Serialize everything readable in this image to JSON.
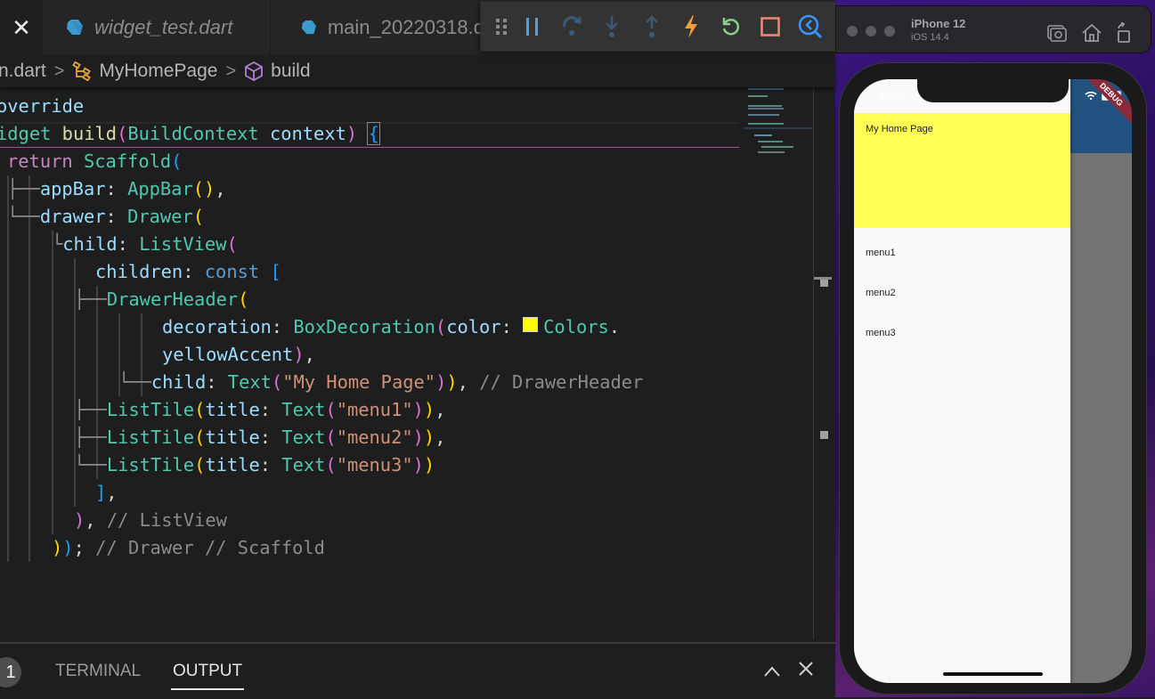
{
  "editor": {
    "tabs": [
      {
        "label": "",
        "icon": "close-icon",
        "active": true
      },
      {
        "label": "widget_test.dart",
        "icon": "dart-icon",
        "italic": true
      },
      {
        "label": "main_20220318.d",
        "icon": "dart-icon"
      }
    ],
    "debug_toolbar": [
      {
        "name": "drag-grip-icon"
      },
      {
        "name": "pause-icon",
        "label": "Pause"
      },
      {
        "name": "step-over-icon",
        "label": "Step Over"
      },
      {
        "name": "step-into-icon",
        "label": "Step Into"
      },
      {
        "name": "step-out-icon",
        "label": "Step Out"
      },
      {
        "name": "hot-reload-icon",
        "label": "Hot Reload",
        "color": "#f0a030"
      },
      {
        "name": "hot-restart-icon",
        "label": "Hot Restart",
        "color": "#89d185"
      },
      {
        "name": "stop-icon",
        "label": "Stop",
        "color": "#f48771"
      },
      {
        "name": "devtools-icon",
        "label": "Open DevTools",
        "color": "#3794ff"
      }
    ],
    "breadcrumb": {
      "file": "n.dart",
      "class": "MyHomePage",
      "method": "build"
    },
    "code_lines": [
      "override",
      "idget build(BuildContext context) {",
      " return Scaffold(",
      "  appBar: AppBar(),",
      "  drawer: Drawer(",
      "    child: ListView(",
      "      children: const [",
      "        DrawerHeader(",
      "            decoration: BoxDecoration(color: Colors.",
      "            yellowAccent),",
      "            child: Text(\"My Home Page\")), // DrawerHeader",
      "        ListTile(title: Text(\"menu1\")),",
      "        ListTile(title: Text(\"menu2\")),",
      "        ListTile(title: Text(\"menu3\"))",
      "      ],",
      "    ), // ListView",
      "  )); // Drawer // Scaffold"
    ],
    "tokens": {
      "l0": "override",
      "l1a": "idget ",
      "l1b": "build",
      "l1c": "(",
      "l1d": "BuildContext",
      "l1e": " context",
      "l1f": ")",
      "l1g": " ",
      "l1h": "{",
      "l2a": "return",
      "l2b": " Scaffold",
      "l2c": "(",
      "l3g": "├──",
      "l3a": "appBar",
      "l3b": ": ",
      "l3c": "AppBar",
      "l3d": "()",
      "l3e": ",",
      "l4g": "└──",
      "l4a": "drawer",
      "l4b": ": ",
      "l4c": "Drawer",
      "l4d": "(",
      "l5g": "└",
      "l5a": "child",
      "l5b": ": ",
      "l5c": "ListView",
      "l5d": "(",
      "l6a": "children",
      "l6b": ": ",
      "l6c": "const",
      "l6d": " [",
      "l7g": "├──",
      "l7a": "DrawerHeader",
      "l7b": "(",
      "l8a": "decoration",
      "l8b": ": ",
      "l8c": "BoxDecoration",
      "l8d": "(",
      "l8e": "color",
      "l8f": ": ",
      "l8h": "Colors",
      "l8i": ".",
      "l9a": "yellowAccent",
      "l9b": ")",
      "l9c": ",",
      "l10g": "└──",
      "l10a": "child",
      "l10b": ": ",
      "l10c": "Text",
      "l10d": "(",
      "l10e": "\"My Home Page\"",
      "l10f": ")",
      "l10h": ")",
      "l10i": ", ",
      "l10j": "// DrawerHeader",
      "l11g": "├──",
      "l12g": "├──",
      "l13g": "└──",
      "lt": "ListTile",
      "lp": "(",
      "lta": "title",
      "ltb": ": ",
      "ltc": "Text",
      "ltd": "(",
      "m1": "\"menu1\"",
      "m2": "\"menu2\"",
      "m3": "\"menu3\"",
      "lte": ")",
      "ltf": ")",
      "ltcomma": ",",
      "l14a": "]",
      "l14b": ",",
      "l15a": ")",
      "l15b": ", ",
      "l15c": "// ListView",
      "l16a": ")",
      "l16b": ")",
      "l16c": "; ",
      "l16d": "// Drawer // Scaffold"
    },
    "swatch_color": "#ffff00",
    "panel": {
      "badge": "1",
      "tabs": [
        {
          "label": "TERMINAL",
          "active": false
        },
        {
          "label": "OUTPUT",
          "active": true
        }
      ],
      "maximize_icon": "^",
      "close_icon": "X"
    }
  },
  "simulator": {
    "device": "iPhone 12",
    "os": "iOS 14.4",
    "toolbar": [
      {
        "name": "screenshot-icon"
      },
      {
        "name": "home-icon"
      },
      {
        "name": "rotate-icon"
      }
    ],
    "status_time": "6:00",
    "debug_banner": "DEBUG",
    "drawer_header": "My Home Page",
    "drawer_header_color": "#ffff55",
    "appbar_color": "#235280",
    "menu_items": [
      "menu1",
      "menu2",
      "menu3"
    ]
  }
}
